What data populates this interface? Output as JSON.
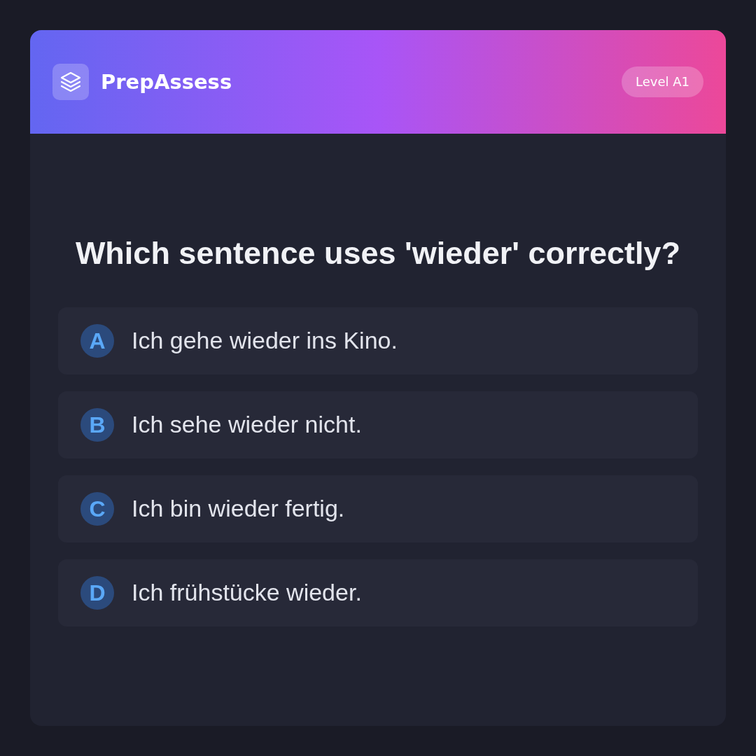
{
  "header": {
    "brand": "PrepAssess",
    "badge": "Level A1"
  },
  "question": "Which sentence uses 'wieder' correctly?",
  "options": [
    {
      "letter": "A",
      "text": "Ich gehe wieder ins Kino."
    },
    {
      "letter": "B",
      "text": "Ich sehe wieder nicht."
    },
    {
      "letter": "C",
      "text": "Ich bin wieder fertig."
    },
    {
      "letter": "D",
      "text": "Ich frühstücke wieder."
    }
  ]
}
